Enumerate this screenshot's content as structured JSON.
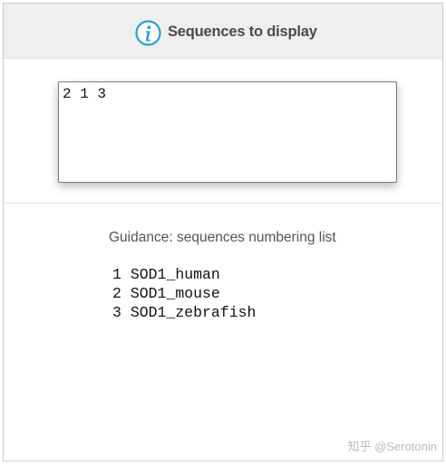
{
  "header": {
    "icon": "info-icon",
    "title": "Sequences to display",
    "accent_color": "#2a9fd6"
  },
  "input": {
    "value": "2 1 3"
  },
  "guidance": {
    "title": "Guidance: sequences numbering list",
    "items": [
      {
        "number": "1",
        "name": "SOD1_human"
      },
      {
        "number": "2",
        "name": "SOD1_mouse"
      },
      {
        "number": "3",
        "name": "SOD1_zebrafish"
      }
    ]
  },
  "watermark": "知乎 @Serotonin"
}
